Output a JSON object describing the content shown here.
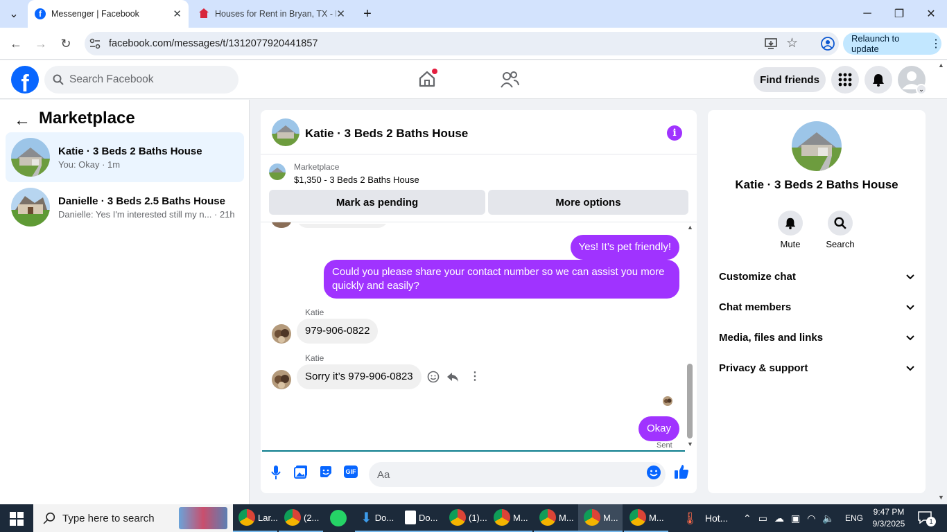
{
  "browser": {
    "tabs": [
      {
        "title": "Messenger | Facebook"
      },
      {
        "title": "Houses for Rent in Bryan, TX - D"
      }
    ],
    "url": "facebook.com/messages/t/1312077920441857",
    "relaunch_label": "Relaunch to update"
  },
  "header": {
    "search_placeholder": "Search Facebook",
    "find_friends_label": "Find friends"
  },
  "sidebar": {
    "title": "Marketplace",
    "conversations": [
      {
        "name": "Katie · 3 Beds 2 Baths House",
        "preview": "You: Okay · 1m"
      },
      {
        "name": "Danielle · 3 Beds 2.5 Baths House",
        "preview": "Danielle: Yes I'm interested still my n... · 21h"
      }
    ]
  },
  "chat": {
    "title": "Katie · 3 Beds 2 Baths House",
    "marketplace_label": "Marketplace",
    "listing": "$1,350 - 3 Beds 2 Baths House",
    "mark_pending_label": "Mark as pending",
    "more_options_label": "More options",
    "messages": [
      {
        "from": "me",
        "text": "Yes! It’s pet friendly!"
      },
      {
        "from": "me",
        "text": "Could you please share your contact number so we can assist you more quickly and easily?"
      },
      {
        "from": "Katie",
        "sender": "Katie",
        "text": "979-906-0822"
      },
      {
        "from": "Katie",
        "sender": "Katie",
        "text": "Sorry it’s 979-906-0823"
      },
      {
        "from": "me",
        "text": "Okay"
      }
    ],
    "sent_label": "Sent",
    "composer_placeholder": "Aa"
  },
  "details": {
    "name": "Katie · 3 Beds 2 Baths House",
    "mute_label": "Mute",
    "search_label": "Search",
    "sections": [
      "Customize chat",
      "Chat members",
      "Media, files and links",
      "Privacy & support"
    ]
  },
  "taskbar": {
    "search_placeholder": "Type here to search",
    "apps": [
      "Lar...",
      "(2...",
      "Do...",
      "Do...",
      "(1)...",
      "M...",
      "M...",
      "M...",
      "M..."
    ],
    "weather": "Hot...",
    "lang": "ENG",
    "time": "9:47 PM",
    "date": "9/3/2025",
    "notif_count": "1"
  },
  "colors": {
    "accent": "#a033ff",
    "fb_blue": "#0866ff"
  }
}
